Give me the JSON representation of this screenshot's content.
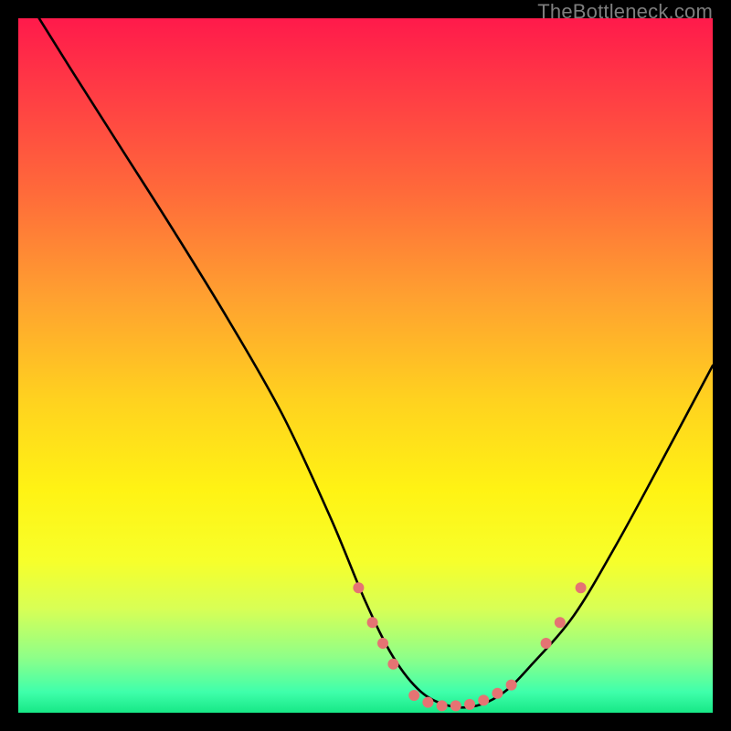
{
  "watermark": "TheBottleneck.com",
  "chart_data": {
    "type": "line",
    "title": "",
    "xlabel": "",
    "ylabel": "",
    "xlim": [
      0,
      100
    ],
    "ylim": [
      0,
      100
    ],
    "grid": false,
    "legend": false,
    "background_gradient": {
      "stops": [
        {
          "offset": 0.0,
          "color": "#ff1a4b"
        },
        {
          "offset": 0.1,
          "color": "#ff3a45"
        },
        {
          "offset": 0.25,
          "color": "#ff6a3a"
        },
        {
          "offset": 0.4,
          "color": "#ffa030"
        },
        {
          "offset": 0.55,
          "color": "#ffd21f"
        },
        {
          "offset": 0.68,
          "color": "#fff314"
        },
        {
          "offset": 0.78,
          "color": "#f7ff2a"
        },
        {
          "offset": 0.85,
          "color": "#d8ff55"
        },
        {
          "offset": 0.92,
          "color": "#8fff88"
        },
        {
          "offset": 0.97,
          "color": "#3fffab"
        },
        {
          "offset": 1.0,
          "color": "#17e886"
        }
      ]
    },
    "series": [
      {
        "name": "bottleneck-curve",
        "color": "#000000",
        "x": [
          3,
          8,
          15,
          22,
          30,
          38,
          45,
          50,
          54,
          58,
          62,
          66,
          70,
          74,
          80,
          86,
          92,
          100
        ],
        "y": [
          100,
          92,
          81,
          70,
          57,
          43,
          28,
          16,
          8,
          3,
          1,
          1,
          3,
          7,
          14,
          24,
          35,
          50
        ]
      }
    ],
    "markers": {
      "name": "highlight-points",
      "color": "#e57373",
      "radius": 6,
      "points": [
        {
          "x": 49,
          "y": 18
        },
        {
          "x": 51,
          "y": 13
        },
        {
          "x": 52.5,
          "y": 10
        },
        {
          "x": 54,
          "y": 7
        },
        {
          "x": 57,
          "y": 2.5
        },
        {
          "x": 59,
          "y": 1.5
        },
        {
          "x": 61,
          "y": 1
        },
        {
          "x": 63,
          "y": 1
        },
        {
          "x": 65,
          "y": 1.2
        },
        {
          "x": 67,
          "y": 1.8
        },
        {
          "x": 69,
          "y": 2.8
        },
        {
          "x": 71,
          "y": 4
        },
        {
          "x": 76,
          "y": 10
        },
        {
          "x": 78,
          "y": 13
        },
        {
          "x": 81,
          "y": 18
        }
      ]
    }
  }
}
